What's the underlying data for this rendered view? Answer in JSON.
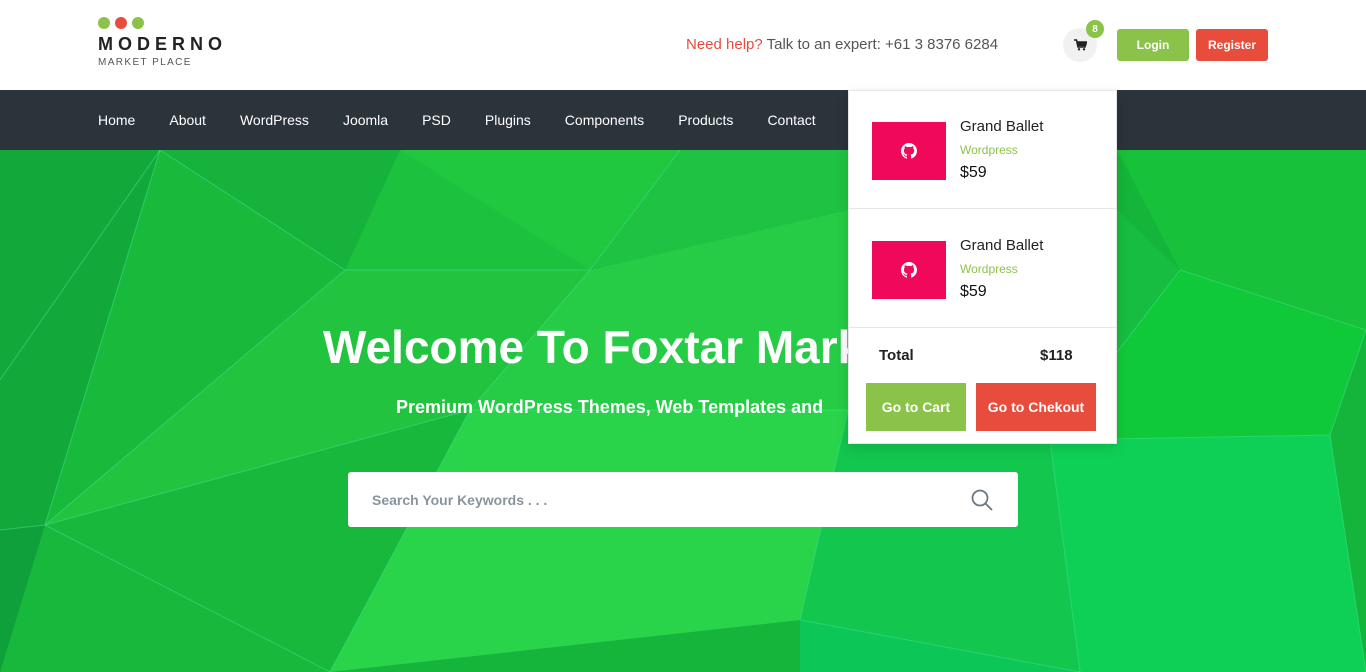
{
  "colors": {
    "green": "#8bc34a",
    "red": "#e74c3c",
    "nav_bg": "#2b333b",
    "thumb_pink": "#f0095b",
    "hero_green": "#14b53a"
  },
  "logo": {
    "name": "MODERNO",
    "tagline": "MARKET PLACE",
    "dots": [
      "#8bc34a",
      "#e74c3c",
      "#8bc34a"
    ]
  },
  "header": {
    "help_accent": "Need help?",
    "help_text": " Talk to an expert: +61 3 8376 6284",
    "cart_icon": "cart-icon",
    "cart_count": "8",
    "login_label": "Login",
    "register_label": "Register"
  },
  "nav": {
    "items": [
      "Home",
      "About",
      "WordPress",
      "Joomla",
      "PSD",
      "Plugins",
      "Components",
      "Products",
      "Contact"
    ]
  },
  "hero": {
    "title": "Welcome To Foxtar Mark",
    "subtitle": "Premium WordPress Themes, Web Templates and",
    "search_placeholder": "Search Your Keywords . . .",
    "search_icon": "search-icon"
  },
  "cart": {
    "items": [
      {
        "name": "Grand Ballet",
        "category": "Wordpress",
        "price": "$59",
        "icon": "github-icon"
      },
      {
        "name": "Grand Ballet",
        "category": "Wordpress",
        "price": "$59",
        "icon": "github-icon"
      }
    ],
    "total_label": "Total",
    "total_value": "$118",
    "go_to_cart_label": "Go to Cart",
    "go_to_checkout_label": "Go to Chekout"
  }
}
